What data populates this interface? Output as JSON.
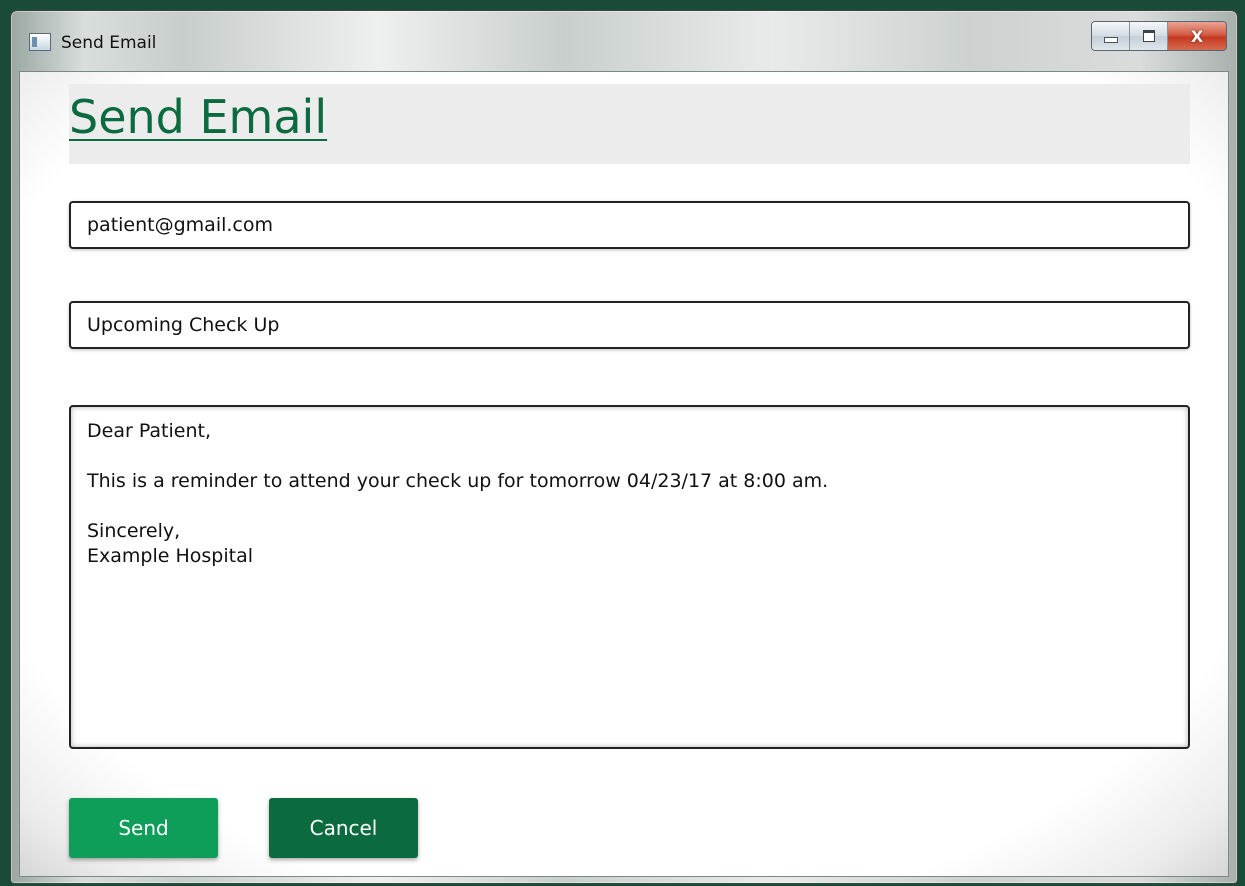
{
  "window": {
    "title": "Send Email",
    "close_glyph": "X"
  },
  "header": {
    "title": "Send Email"
  },
  "form": {
    "to_value": "patient@gmail.com",
    "subject_value": "Upcoming Check Up",
    "body_value": "Dear Patient,\n\nThis is a reminder to attend your check up for tomorrow 04/23/17 at 8:00 am.\n\nSincerely,\nExample Hospital"
  },
  "actions": {
    "send_label": "Send",
    "cancel_label": "Cancel"
  },
  "colors": {
    "accent": "#0b6b3f",
    "send_button": "#0e9e5a",
    "cancel_button": "#0b6b3f"
  },
  "icons": {
    "app": "window-app-icon",
    "minimize": "minimize-icon",
    "maximize": "maximize-icon",
    "close": "close-icon"
  }
}
